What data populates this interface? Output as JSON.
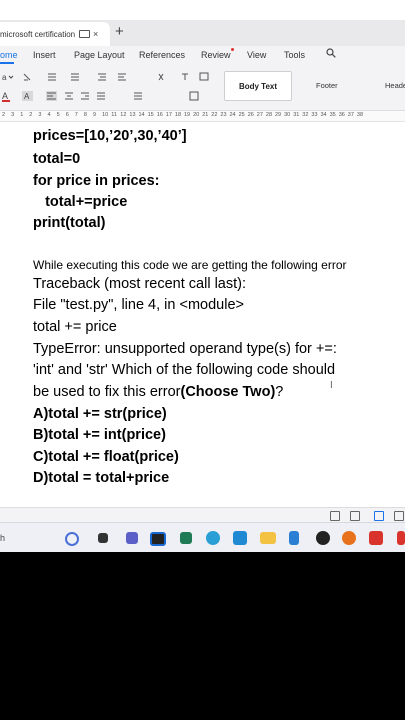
{
  "browser": {
    "tab_title": "microsoft certification",
    "new_tab_symbol": "+",
    "close_symbol": "×"
  },
  "menu": {
    "items": [
      "ome",
      "Insert",
      "Page Layout",
      "References",
      "Review",
      "View",
      "Tools"
    ]
  },
  "styles": {
    "body_text": "Body Text",
    "footer": "Footer",
    "header": "Heade"
  },
  "ruler": [
    "2",
    "3",
    "1",
    "2",
    "3",
    "4",
    "5",
    "6",
    "7",
    "8",
    "9",
    "10",
    "11",
    "12",
    "13",
    "14",
    "15",
    "16",
    "17",
    "18",
    "19",
    "20",
    "21",
    "22",
    "23",
    "24",
    "25",
    "26",
    "27",
    "28",
    "29",
    "30",
    "31",
    "32",
    "33",
    "34",
    "35",
    "36",
    "37",
    "38"
  ],
  "document": {
    "code_lines": [
      "prices=[10,’20’,30,’40’]",
      "total=0",
      "for price in prices:",
      "   total+=price",
      "print(total)"
    ],
    "intro": "While executing this code we are getting the following error",
    "error_lines": [
      "Traceback (most recent call last):",
      "File \"test.py\", line 4, in <module>",
      "total += price",
      "TypeError: unsupported operand type(s) for +=:",
      "'int' and 'str' Which of the following code should"
    ],
    "question_prefix": "be used to fix this error",
    "question_bold": "(Choose Two)",
    "question_suffix": "?",
    "options": [
      "A)total += str(price)",
      "B)total += int(price)",
      "C)total += float(price)",
      "D)total = total+price"
    ]
  },
  "taskbar": {
    "search_fragment": "h"
  },
  "colors": {
    "accent": "#1a73e8",
    "page_background": "#000000",
    "toolbar": "#f3f3f5"
  }
}
